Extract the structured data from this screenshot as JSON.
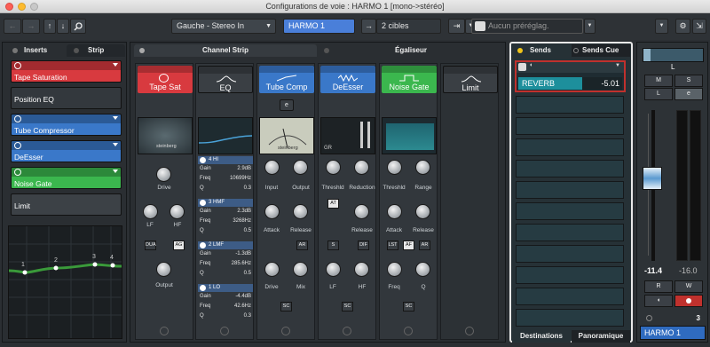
{
  "window": {
    "title": "Configurations de voie : HARMO 1 [mono->stéréo]"
  },
  "toolbar": {
    "routing": "Gauche - Stereo In",
    "channel_name": "HARMO 1",
    "targets": "2 cibles",
    "preset_placeholder": "Aucun préréglag."
  },
  "left_pane": {
    "tab_inserts": "Inserts",
    "tab_strip": "Strip",
    "slots": [
      {
        "label": "Tape Saturation",
        "color": "#d83a3f"
      },
      {
        "label": "Position EQ",
        "color": "#33383d"
      },
      {
        "label": "Tube Compressor",
        "color": "#3a78c9"
      },
      {
        "label": "DeEsser",
        "color": "#3a78c9"
      },
      {
        "label": "Noise Gate",
        "color": "#3bb74e"
      },
      {
        "label": "Limit",
        "color": "#3c4146"
      }
    ],
    "eq_points": [
      "1",
      "2",
      "3",
      "4"
    ]
  },
  "channel_strip": {
    "tab_channel": "Channel Strip",
    "tab_eq": "Égaliseur",
    "modules": [
      {
        "name": "Tape Sat",
        "color": "#d83a3f"
      },
      {
        "name": "EQ",
        "color": "#3a3f44"
      },
      {
        "name": "Tube Comp",
        "color": "#3a78c9"
      },
      {
        "name": "DeEsser",
        "color": "#3a78c9"
      },
      {
        "name": "Noise Gate",
        "color": "#3bb74e"
      },
      {
        "name": "Limit",
        "color": "#3a3f44"
      }
    ],
    "tapesat": {
      "brand": "steinberg",
      "drive": "Drive",
      "lf": "LF",
      "hf": "HF",
      "dua": "DUA",
      "ag": "AG",
      "output": "Output"
    },
    "eq_bands": [
      {
        "name": "4 HI",
        "gain": "2.9dB",
        "freq": "10699Hz",
        "q": "0.3"
      },
      {
        "name": "3 HMF",
        "gain": "2.3dB",
        "freq": "3268Hz",
        "q": "0.5"
      },
      {
        "name": "2 LMF",
        "gain": "-1.3dB",
        "freq": "285.6Hz",
        "q": "0.5"
      },
      {
        "name": "1 LO",
        "gain": "-4.4dB",
        "freq": "42.6Hz",
        "q": "0.3"
      }
    ],
    "eq_labels": {
      "gain": "Gain",
      "freq": "Freq",
      "q": "Q"
    },
    "tubecomp": {
      "brand": "steinberg",
      "input": "Input",
      "output": "Output",
      "attack": "Attack",
      "release": "Release",
      "ar": "AR",
      "drive": "Drive",
      "mix": "Mix",
      "sc": "SC"
    },
    "deesser": {
      "gr": "GR",
      "threshld": "Threshld",
      "reduction": "Reduction",
      "at": "AT",
      "release": "Release",
      "s": "S",
      "dif": "DIF",
      "lf": "LF",
      "hf": "HF",
      "sc": "SC"
    },
    "noisegate": {
      "threshld": "Threshld",
      "range": "Range",
      "attack": "Attack",
      "release": "Release",
      "lst": "LST",
      "af": "AF",
      "ar": "AR",
      "freq": "Freq",
      "q": "Q",
      "sc": "SC"
    }
  },
  "sends": {
    "tab_sends": "Sends",
    "tab_cue": "Sends Cue",
    "slot_name": "REVERB",
    "slot_value": "-5.01",
    "tab_destinations": "Destinations",
    "tab_pan": "Panoramique"
  },
  "fader": {
    "pan": "L",
    "m": "M",
    "s": "S",
    "l": "L",
    "e": "e",
    "value_left": "-11.4",
    "value_right": "-16.0",
    "r": "R",
    "w": "W",
    "channel_number": "3",
    "channel_name": "HARMO 1",
    "level": 0.55
  }
}
